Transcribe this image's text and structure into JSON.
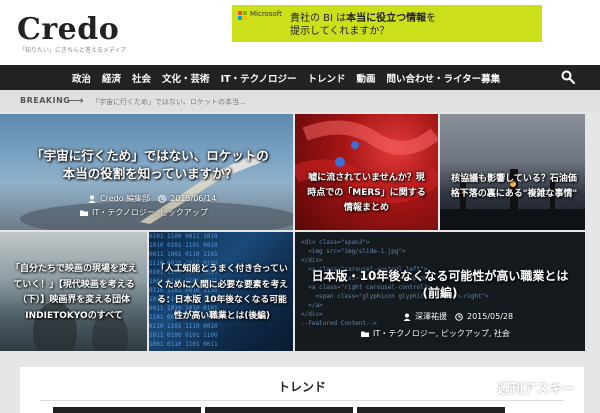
{
  "site": {
    "logo": "Credo",
    "tagline": "「知りたい」にきちんと答えるメディア"
  },
  "ad": {
    "brand": "Microsoft",
    "text_line1_pre": "貴社の BI は",
    "text_line1_bold": "本当に役立つ情報",
    "text_line1_post": "を",
    "text_line2": "提示してくれますか？",
    "colors": [
      "#f25022",
      "#7fba00",
      "#00a4ef",
      "#ffb900"
    ],
    "background": "#cbe01b"
  },
  "nav": {
    "items": [
      "政治",
      "経済",
      "社会",
      "文化・芸術",
      "IT・テクノロジー",
      "トレンド",
      "動画",
      "問い合わせ・ライター募集"
    ],
    "search_icon": "search-icon"
  },
  "breaking": {
    "label": "BREAKING",
    "arrow": "⟶",
    "text": "「宇宙に行くため」ではない、ロケットの本当..."
  },
  "tiles": [
    {
      "caption": "「宇宙に行くため」ではない、ロケットの本当の役割を知っていますか？",
      "author": "Credo 編集部",
      "date": "2015/06/14",
      "categories": "IT・テクノロジー, ピックアップ"
    },
    {
      "caption": "嘘に流されていませんか？現時点での「MERS」に関する情報まとめ"
    },
    {
      "caption": "核協議も影響している？石油価格下落の裏にある\"複雑な事情\""
    },
    {
      "caption": "「自分たちで映画の現場を変えていく！」【現代映画を考える（下）】映画界を変える団体INDIETOKYOのすべて"
    },
    {
      "caption": "「人工知能とうまく付き合っていくために人間に必要な要素を考える：日本版 10年後なくなる可能性が高い職業とは(後編)"
    },
    {
      "caption": "日本版・10年後なくなる可能性が高い職業とは(前編)",
      "author": "深澤祐援",
      "date": "2015/05/28",
      "categories": "IT・テクノロジー, ピックアップ, 社会"
    }
  ],
  "trend": {
    "title": "トレンド"
  },
  "watermark": "週刊アスキー"
}
